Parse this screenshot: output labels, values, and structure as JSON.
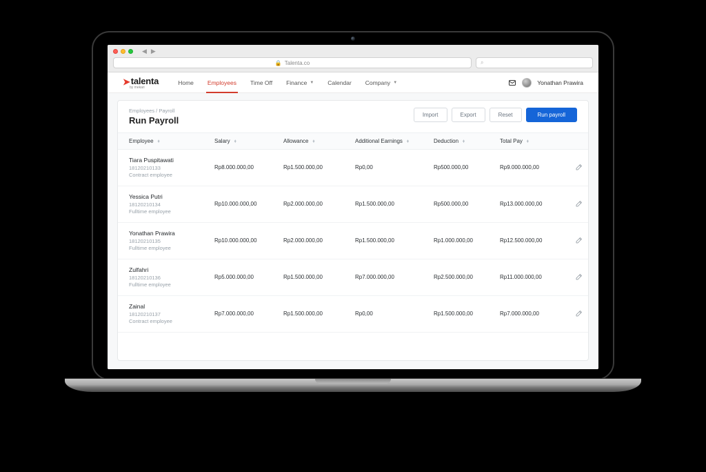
{
  "browser": {
    "url_host": "Talenta.co",
    "search_placeholder": ""
  },
  "header": {
    "brand": "talenta",
    "brand_sub": "by mekari",
    "nav": [
      "Home",
      "Employees",
      "Time Off",
      "Finance",
      "Calendar",
      "Company"
    ],
    "nav_active_index": 1,
    "nav_dropdown_indices": [
      3,
      5
    ],
    "user_name": "Yonathan Prawira"
  },
  "page": {
    "breadcrumbs": "Employees / Payroll",
    "title": "Run Payroll",
    "actions": {
      "import": "Import",
      "export": "Export",
      "reset": "Reset",
      "run": "Run payroll"
    }
  },
  "table": {
    "columns": [
      "Employee",
      "Salary",
      "Allowance",
      "Additional Earnings",
      "Deduction",
      "Total Pay"
    ],
    "rows": [
      {
        "name": "Tiara Puspitawati",
        "id": "18120210133",
        "type": "Contract employee",
        "salary": "Rp8.000.000,00",
        "allowance": "Rp1.500.000,00",
        "additional": "Rp0,00",
        "deduction": "Rp500.000,00",
        "total": "Rp9.000.000,00"
      },
      {
        "name": "Yessica Putri",
        "id": "18120210134",
        "type": "Fulltime employee",
        "salary": "Rp10.000.000,00",
        "allowance": "Rp2.000.000,00",
        "additional": "Rp1.500.000,00",
        "deduction": "Rp500.000,00",
        "total": "Rp13.000.000,00"
      },
      {
        "name": "Yonathan Prawira",
        "id": "18120210135",
        "type": "Fulltime employee",
        "salary": "Rp10.000.000,00",
        "allowance": "Rp2.000.000,00",
        "additional": "Rp1.500.000,00",
        "deduction": "Rp1.000.000,00",
        "total": "Rp12.500.000,00"
      },
      {
        "name": "Zulfahri",
        "id": "18120210136",
        "type": "Fulltime employee",
        "salary": "Rp5.000.000,00",
        "allowance": "Rp1.500.000,00",
        "additional": "Rp7.000.000,00",
        "deduction": "Rp2.500.000,00",
        "total": "Rp11.000.000,00"
      },
      {
        "name": "Zainal",
        "id": "18120210137",
        "type": "Contract employee",
        "salary": "Rp7.000.000,00",
        "allowance": "Rp1.500.000,00",
        "additional": "Rp0,00",
        "deduction": "Rp1.500.000,00",
        "total": "Rp7.000.000,00"
      }
    ]
  }
}
